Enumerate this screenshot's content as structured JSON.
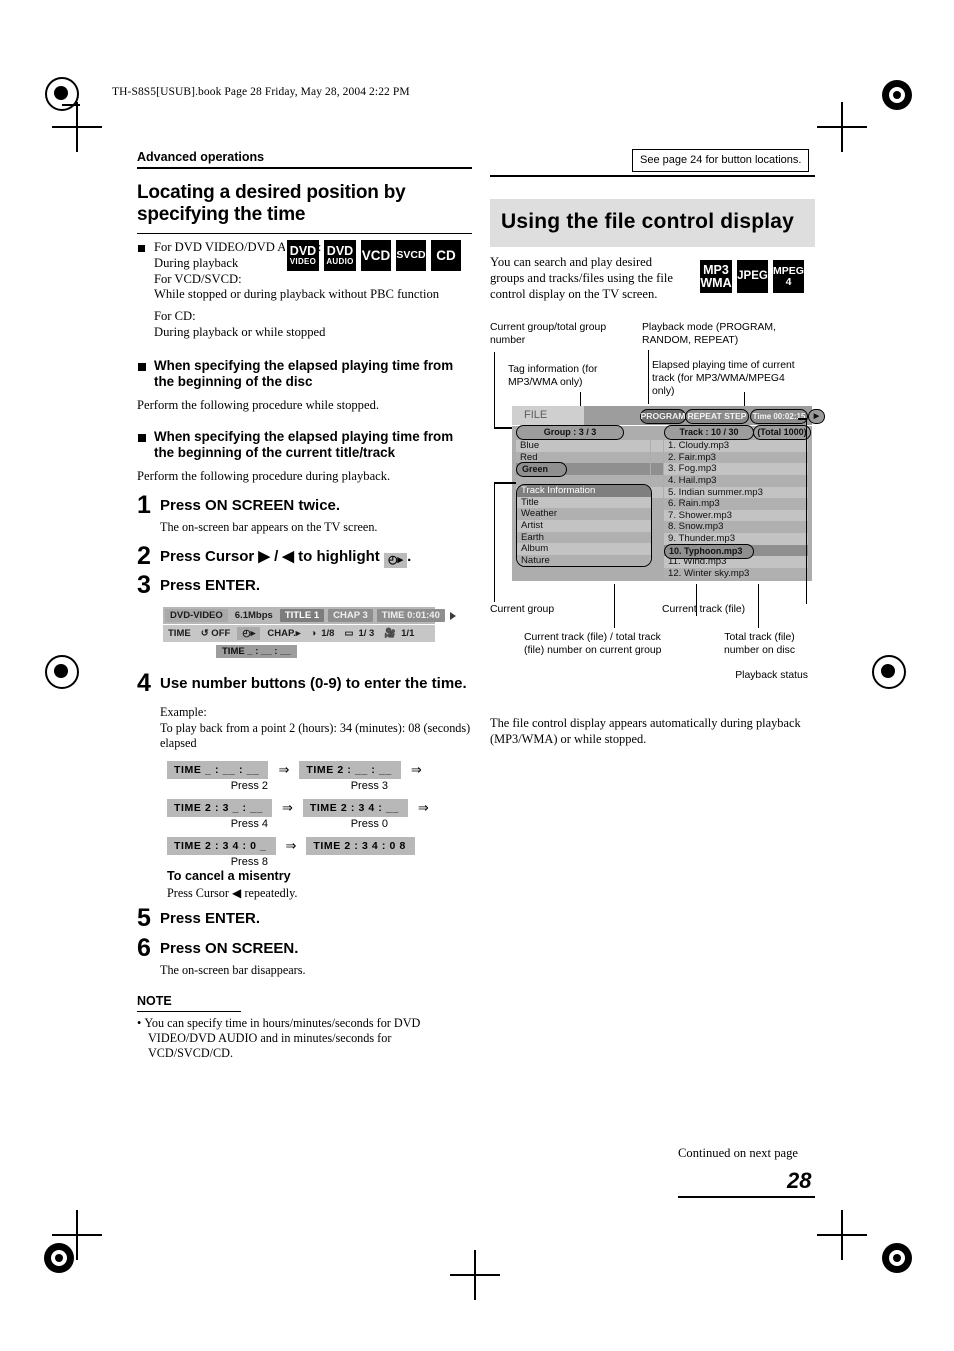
{
  "file_header": "TH-S8S5[USUB].book  Page 28  Friday, May 28, 2004  2:22 PM",
  "breadcrumb": "Advanced operations",
  "see_page_note": "See page 24 for button locations.",
  "left": {
    "title": "Locating a desired position by specifying the time",
    "disc_note_line1": "For DVD VIDEO/DVD AUDIO:",
    "disc_note_line2": "During playback",
    "disc_note_line3": "For VCD/SVCD:",
    "disc_note_line4": "While stopped or during playback without PBC function",
    "disc_note_line5": "For CD:",
    "disc_note_line6": "During playback or while stopped",
    "badges": [
      {
        "line1": "DVD",
        "line2": "VIDEO"
      },
      {
        "line1": "DVD",
        "line2": "AUDIO"
      },
      {
        "line1": "VCD",
        "line2": ""
      },
      {
        "line1": "SVCD",
        "line2": ""
      },
      {
        "line1": "CD",
        "line2": ""
      }
    ],
    "head1": "When specifying the elapsed playing time from the beginning of the disc",
    "head1_sub": "Perform the following procedure while stopped.",
    "head2": "When specifying the elapsed playing time from the beginning of the current title/track",
    "head2_sub": "Perform the following procedure during playback.",
    "steps": [
      {
        "num": "1",
        "text": "Press ON SCREEN twice.",
        "sub": "The on-screen bar appears on the TV screen."
      },
      {
        "num": "2",
        "text_pre": "Press Cursor",
        "text_mid": "▶ / ◀",
        "text_post": "to highlight",
        "glyph": "◴▸",
        "text_end": "."
      },
      {
        "num": "3",
        "text": "Press ENTER.",
        "sub": ""
      },
      {
        "num": "4",
        "text": "Use number buttons (0-9) to enter the time.",
        "sub": ""
      },
      {
        "num": "5",
        "text": "Press ENTER.",
        "sub": ""
      },
      {
        "num": "6",
        "text": "Press ON SCREEN.",
        "sub": "The on-screen bar disappears."
      }
    ],
    "onscreen_bar": {
      "disc_type": "DVD-VIDEO",
      "bitrate": "6.1Mbps",
      "title_chip": "TITLE 1",
      "chap_chip": "CHAP 3",
      "time_chip": "TIME  0:01:40",
      "row2_time": "TIME",
      "row2_repeat": "↺ OFF",
      "row2_timesearch": "◴▸",
      "row2_chapsearch": "CHAP.▸",
      "row2_audio": "1/8",
      "row2_subtitle": "1/ 3",
      "row2_angle": "1/1",
      "row3_input": "TIME  _ : __ : __"
    },
    "example_label": "Example:",
    "example_text": "To play back from a point 2 (hours): 34 (minutes): 08 (seconds) elapsed",
    "time_sequence": [
      {
        "chips": [
          "TIME  _ : __ : __",
          "TIME  2 : __ : __"
        ],
        "presses": [
          "Press 2",
          "Press 3"
        ],
        "trailing_arrow": true
      },
      {
        "chips": [
          "TIME  2 : 3 _ : __",
          "TIME  2 : 3 4 : __"
        ],
        "presses": [
          "Press 4",
          "Press 0"
        ],
        "trailing_arrow": true
      },
      {
        "chips": [
          "TIME  2 : 3 4 : 0 _",
          "TIME  2 : 3 4 : 0 8"
        ],
        "presses": [
          "Press 8",
          ""
        ],
        "trailing_arrow": false
      }
    ],
    "cancel_head": "To cancel a misentry",
    "cancel_text_pre": "Press Cursor",
    "cancel_glyph": "◀",
    "cancel_text_post": "repeatedly.",
    "note_head": "NOTE",
    "note_item": "You can specify time in hours/minutes/seconds for DVD VIDEO/DVD AUDIO and in minutes/seconds for VCD/SVCD/CD."
  },
  "right": {
    "title": "Using the file control display",
    "intro": "You can search and play desired groups and tracks/files using the file control display on the TV screen.",
    "badges": [
      {
        "line1": "MP3",
        "line2": "WMA"
      },
      {
        "line1": "JPEG",
        "line2": ""
      },
      {
        "line1": "MPEG",
        "line2": "4"
      }
    ],
    "callouts": {
      "current_group_total": "Current group/total group number",
      "playback_mode": "Playback mode (PROGRAM, RANDOM, REPEAT)",
      "tag_information": "Tag information (for MP3/WMA only)",
      "elapsed_time": "Elapsed playing time of current track (for MP3/WMA/MPEG4 only)",
      "current_group": "Current group",
      "current_track_file": "Current track (file)",
      "current_total_track": "Current track (file) / total track (file) number on current group",
      "total_track_disc": "Total track (file) number on disc",
      "playback_status": "Playback status"
    },
    "screen": {
      "file_label": "FILE",
      "program_chip": "PROGRAM",
      "repeat_chip": "REPEAT STEP",
      "time_chip": "Time 00:02:15",
      "play_icon": "▶",
      "group_header": "Group :  3 / 3",
      "track_header": "Track :  10 / 30",
      "total_chip": "(Total  1000)",
      "groups": [
        "Blue",
        "Red",
        "Green"
      ],
      "selected_group": "Green",
      "track_info_header": "Track  Information",
      "track_info_rows": [
        "Title",
        "Weather",
        "Artist",
        "Earth",
        "Album",
        "Nature"
      ],
      "tracks": [
        "1. Cloudy.mp3",
        "2. Fair.mp3",
        "3. Fog.mp3",
        "4. Hail.mp3",
        "5. Indian summer.mp3",
        "6. Rain.mp3",
        "7. Shower.mp3",
        "8. Snow.mp3",
        "9. Thunder.mp3",
        "10. Typhoon.mp3",
        "11. Wind.mp3",
        "12. Winter sky.mp3"
      ],
      "selected_track": "10. Typhoon.mp3"
    },
    "fcd_note": "The file control display appears automatically during playback (MP3/WMA) or while stopped."
  },
  "footer": {
    "continued": "Continued on next page",
    "page_number": "28"
  }
}
